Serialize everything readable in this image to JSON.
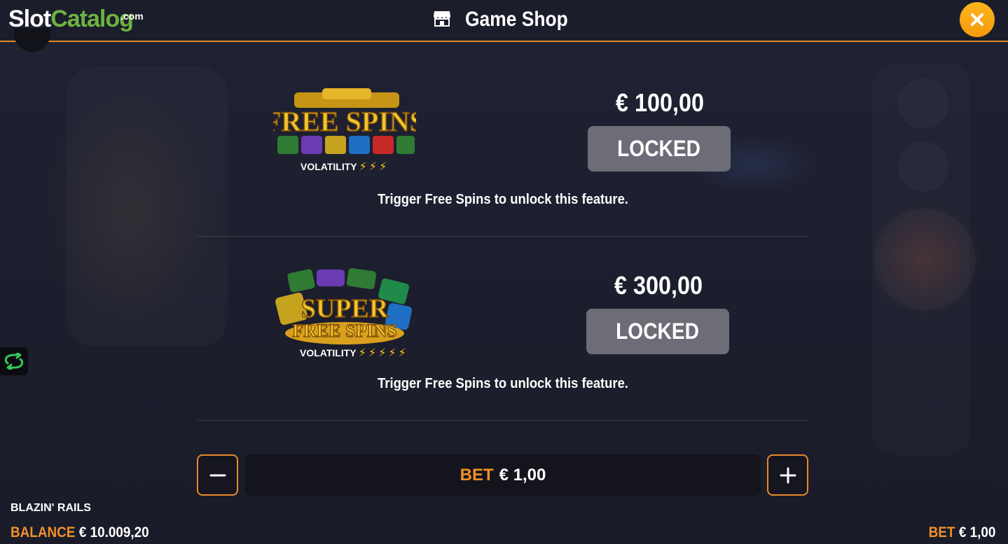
{
  "header": {
    "logo_slot": "Slot",
    "logo_catalog": "Catalog",
    "logo_com": ".com",
    "title": "Game Shop",
    "shop_icon": "storefront-icon",
    "close_icon": "close-icon"
  },
  "features": [
    {
      "logo_text": "FREE SPINS",
      "volatility_label": "VOLATILITY",
      "volatility_level": 3,
      "price": "€ 100,00",
      "button_label": "LOCKED",
      "message": "Trigger Free Spins to unlock this feature."
    },
    {
      "logo_text_top": "SUPER",
      "logo_text_bottom": "FREE SPINS",
      "volatility_label": "VOLATILITY",
      "volatility_level": 5,
      "price": "€ 300,00",
      "button_label": "LOCKED",
      "message": "Trigger Free Spins to unlock this feature."
    }
  ],
  "bet_bar": {
    "label": "BET",
    "value": "€ 1,00",
    "minus_icon": "minus-icon",
    "plus_icon": "plus-icon"
  },
  "footer": {
    "game_name": "BLAZIN' RAILS",
    "balance_label": "BALANCE",
    "balance_value": "€ 10.009,20",
    "bet_label": "BET",
    "bet_value": "€ 1,00"
  },
  "colors": {
    "accent": "#e8892a",
    "close_button": "#f7a416",
    "locked_button": "#6c6d76",
    "background": "#1b1d2c",
    "logo_green": "#6cb33f",
    "bolt": "#ffc21a"
  }
}
